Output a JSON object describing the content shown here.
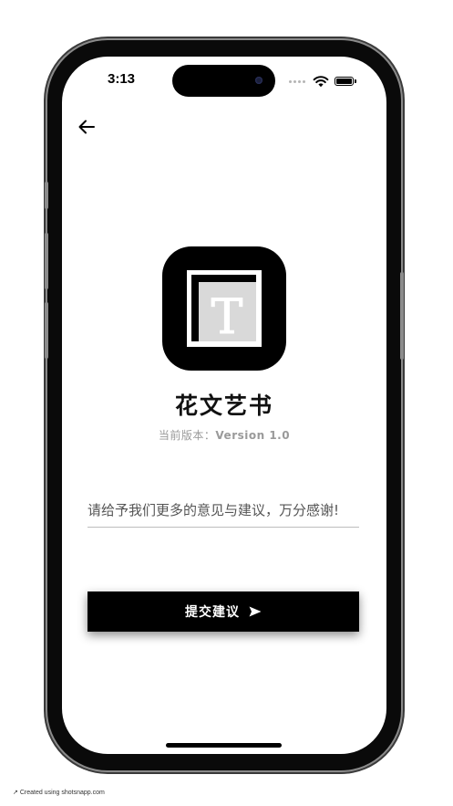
{
  "status_bar": {
    "time": "3:13"
  },
  "app": {
    "name": "花文艺书",
    "version_label": "当前版本：",
    "version_value": "Version 1.0",
    "icon_letter": "T"
  },
  "feedback": {
    "placeholder": "请给予我们更多的意见与建议，万分感谢!",
    "value": ""
  },
  "submit": {
    "label": "提交建议"
  },
  "footer": {
    "arrow": "↗",
    "text": "Created using shotsnapp.com"
  },
  "colors": {
    "primary": "#000000",
    "background": "#ffffff",
    "muted": "#9a9a9a"
  }
}
